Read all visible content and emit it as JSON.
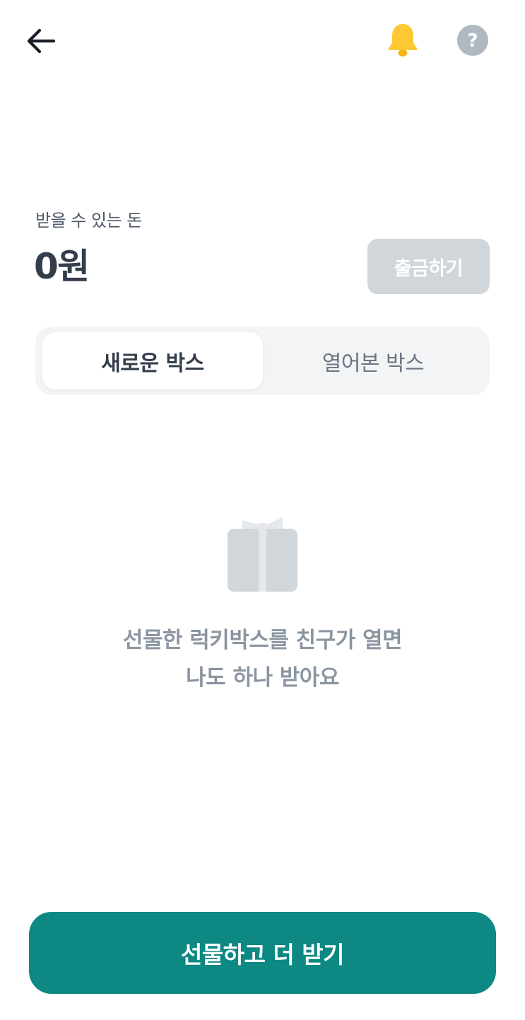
{
  "header": {
    "back_icon": "arrow-left-icon",
    "bell_icon": "bell-icon",
    "help_icon": "question-circle-icon",
    "help_glyph": "?"
  },
  "balance": {
    "label": "받을 수 있는 돈",
    "amount": "0원",
    "withdraw_label": "출금하기"
  },
  "tabs": [
    {
      "label": "새로운 박스",
      "selected": true
    },
    {
      "label": "열어본 박스",
      "selected": false
    }
  ],
  "empty_state": {
    "icon": "gift-box-icon",
    "line1": "선물한 럭키박스를 친구가 열면",
    "line2": "나도 하나 받아요"
  },
  "cta": {
    "label": "선물하고 더 받기"
  },
  "colors": {
    "accent": "#0d8883",
    "bell": "#fcc934",
    "disabled_button": "#d1d6db",
    "help_circle": "#b0b8c1",
    "text_primary": "#333d4b",
    "text_muted": "#8b95a1"
  }
}
